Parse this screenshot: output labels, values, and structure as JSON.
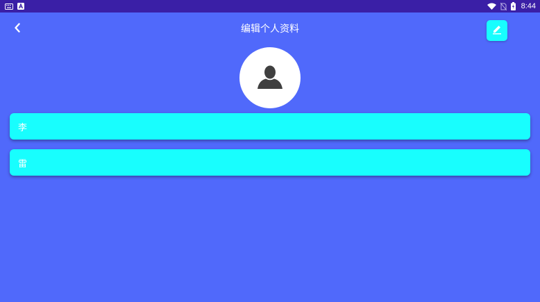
{
  "status_bar": {
    "time": "8:44",
    "left_icons": [
      "keyboard-icon",
      "a-notification-icon"
    ],
    "right_icons": [
      "wifi-icon",
      "no-sim-icon",
      "battery-icon"
    ]
  },
  "header": {
    "title": "编辑个人资料",
    "back_icon": "chevron-left-icon",
    "edit_icon": "edit-icon"
  },
  "profile": {
    "avatar_icon": "person-silhouette-icon"
  },
  "fields": {
    "surname": "李",
    "given_name": "雷"
  },
  "colors": {
    "background": "#5069fb",
    "status_bar": "#3a1fa6",
    "accent_cyan": "#18fefe",
    "text": "#ffffff"
  }
}
